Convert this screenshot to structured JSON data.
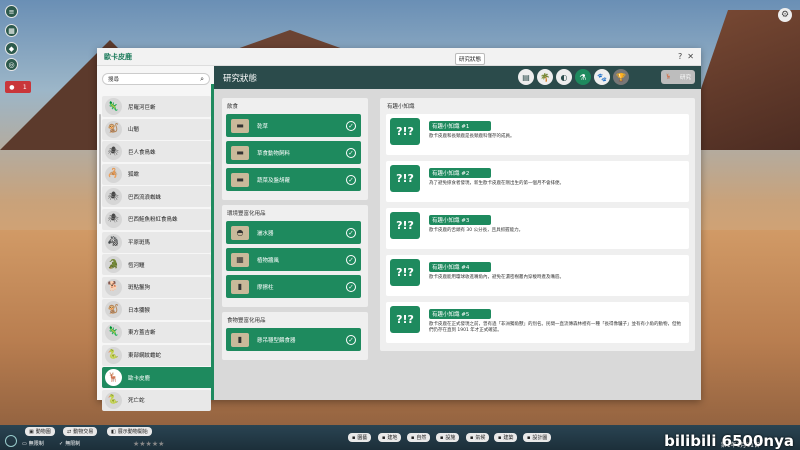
{
  "window": {
    "title": "歐卡皮鹿",
    "help": "?",
    "close": "✕",
    "tooltip": "研究狀態"
  },
  "search": {
    "value": "搜尋",
    "icon": "search-icon"
  },
  "species": [
    {
      "name": "尼羅河巨蜥",
      "icon": "🦎"
    },
    {
      "name": "山魈",
      "icon": "🐒"
    },
    {
      "name": "巨人食鳥蛛",
      "icon": "🕷"
    },
    {
      "name": "狐蠍",
      "icon": "🦂"
    },
    {
      "name": "巴西流浪蜘蛛",
      "icon": "🕷"
    },
    {
      "name": "巴西鮭魚粉紅食鳥蛛",
      "icon": "🕷"
    },
    {
      "name": "平原斑馬",
      "icon": "🦓"
    },
    {
      "name": "恆河鱷",
      "icon": "🐊"
    },
    {
      "name": "斑點鬣狗",
      "icon": "🐕"
    },
    {
      "name": "日本獼猴",
      "icon": "🐒"
    },
    {
      "name": "東方蓋吉蜥",
      "icon": "🦎"
    },
    {
      "name": "東部網紋蟾蛇",
      "icon": "🐍"
    },
    {
      "name": "歐卡皮鹿",
      "icon": "🦌",
      "selected": true
    },
    {
      "name": "死亡蛇",
      "icon": "🐍"
    }
  ],
  "header": {
    "title": "研究狀態",
    "tabs": [
      {
        "name": "tab-overview",
        "glyph": "▤"
      },
      {
        "name": "tab-habitat",
        "glyph": "🌴"
      },
      {
        "name": "tab-diet",
        "glyph": "◐"
      },
      {
        "name": "tab-research",
        "glyph": "⚗",
        "active": true
      },
      {
        "name": "tab-paw",
        "glyph": "🐾"
      },
      {
        "name": "tab-trophy",
        "glyph": "🏆",
        "disabled": true
      }
    ],
    "action_button": "研究"
  },
  "diet": {
    "heading": "飲食",
    "items": [
      {
        "label": "乾草"
      },
      {
        "label": "草食動物飼料"
      },
      {
        "label": "蔬菜及盤胡蘿"
      }
    ]
  },
  "enrichment": {
    "heading": "環境豐富化用品",
    "items": [
      {
        "label": "灑水器"
      },
      {
        "label": "植物牆風"
      },
      {
        "label": "摩擦柱"
      }
    ]
  },
  "food_enrichment": {
    "heading": "食物豐富化用品",
    "items": [
      {
        "label": "懸吊穩型餵食器"
      }
    ]
  },
  "facts": {
    "heading": "有趣小知識",
    "items": [
      {
        "title": "有趣小知識 #1",
        "text": "歐卡皮鹿和長頸鹿是長頸鹿科僅存的成員。"
      },
      {
        "title": "有趣小知識 #2",
        "text": "為了避免掠食者發現，新生歐卡皮鹿在剛出生的第一個月不會排便。"
      },
      {
        "title": "有趣小知識 #3",
        "text": "歐卡皮鹿的舌頭有 30 公分長，且具抓握能力。"
      },
      {
        "title": "有趣小知識 #4",
        "text": "歐卡皮鹿能用瓊球收進嘴角內，避免在濃密樹叢內穿梭時產及嘴唇。"
      },
      {
        "title": "有趣小知識 #5",
        "text": "歐卡皮鹿在正式發現之前，曾有過「非洲獨角獸」的別名。民間一直流傳森林裡有一種「長得像驢子」並有有小角的動物，但牠們仍存在直到 1901 年才正式確認。"
      }
    ]
  },
  "bottom": {
    "btn1": "動物園",
    "btn2": "動物交易",
    "btn3": "展示動物開始",
    "money": "無限制",
    "money2": "無限制",
    "tools": [
      "園藝",
      "建地",
      "自然",
      "設施",
      "氣候",
      "建築",
      "設計圖"
    ],
    "date": "第1年1月11日",
    "watermark": "bilibili 6500nya"
  },
  "sidebar": {
    "alert_count": "1"
  }
}
